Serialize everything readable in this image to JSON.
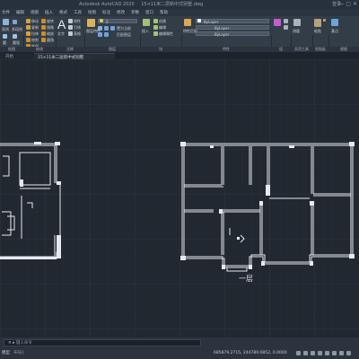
{
  "app": {
    "title": "Autodesk AutoCAD 2020",
    "filename": "15×11米二层新中式别墅.dwg",
    "sign_in": "登录"
  },
  "menu_tabs": [
    "文件",
    "编辑",
    "视图",
    "插入",
    "格式",
    "工具",
    "绘图",
    "标注",
    "修改",
    "参数",
    "窗口",
    "帮助"
  ],
  "ribbon": {
    "draw_panel": {
      "label": "绘图",
      "items": [
        "直线",
        "多段线",
        "圆",
        "圆弧"
      ]
    },
    "modify_panel": {
      "label": "修改",
      "items": [
        "移动",
        "旋转",
        "修剪",
        "复制",
        "镜像",
        "圆角",
        "拉伸",
        "缩放",
        "阵列"
      ]
    },
    "text_label": "文字",
    "annotation_panel": {
      "label": "注释",
      "items": [
        "线性",
        "引线",
        "表格"
      ]
    },
    "layers_panel": {
      "label": "图层",
      "layer_value": "0",
      "items": [
        "图层特性",
        "置为当前",
        "匹配图层"
      ]
    },
    "block_panel": {
      "label": "块",
      "items": [
        "插入",
        "创建",
        "编辑",
        "编辑属性"
      ]
    },
    "properties_panel": {
      "label": "特性",
      "color_value": "ByLayer",
      "linetype_value": "ByLayer",
      "lineweight_value": "ByLayer",
      "match_label": "特性匹配"
    },
    "groups_panel": {
      "label": "组"
    },
    "utilities_panel": {
      "label": "实用工具",
      "measure_label": "测量"
    },
    "clipboard_panel": {
      "label": "剪贴板",
      "paste_label": "粘贴"
    },
    "view_panel": {
      "label": "视图",
      "base_label": "基点"
    }
  },
  "file_tabs": {
    "start": "开始",
    "drawing": "15×11米二层新中式别墅"
  },
  "canvas": {
    "floor_label": "一层"
  },
  "command_line": {
    "placeholder": "键入命令"
  },
  "status": {
    "coordinates": "685879.2715, 244789.0852, 0.0000",
    "model_tab": "模型",
    "layout_tab": "布局1"
  },
  "colors": {
    "background": "#212830",
    "grid_minor": "#283039",
    "grid_major": "#2f3843",
    "wall": "#e6e9ee"
  }
}
